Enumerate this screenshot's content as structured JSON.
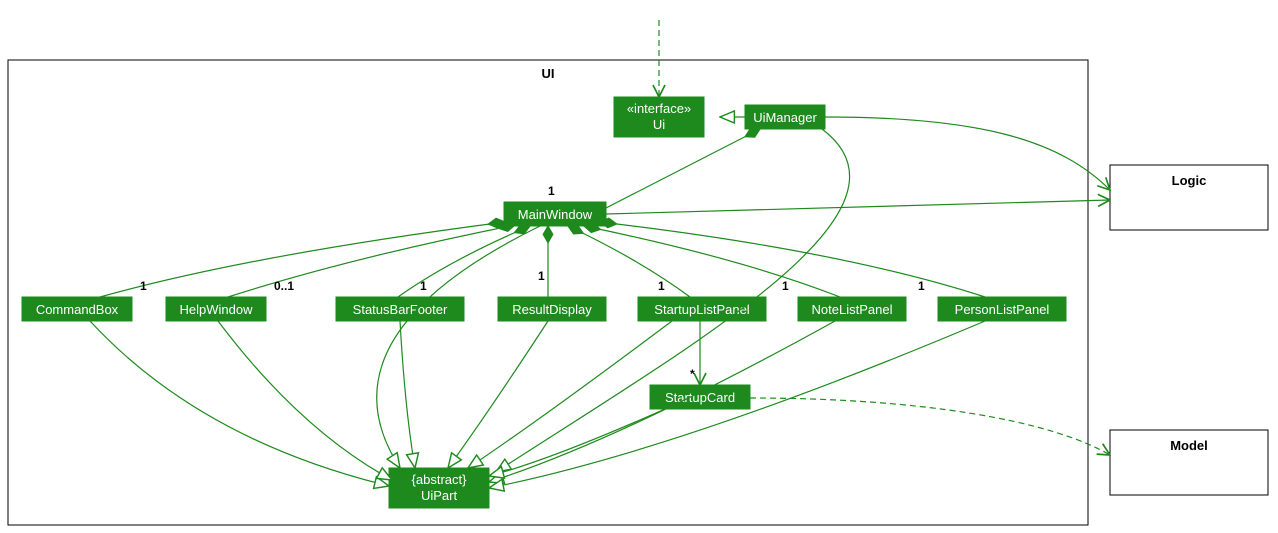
{
  "package": {
    "name": "UI"
  },
  "external": {
    "logic": "Logic",
    "model": "Model"
  },
  "classes": {
    "ui_iface": {
      "stereotype": "«interface»",
      "name": "Ui"
    },
    "ui_manager": "UiManager",
    "main_window": "MainWindow",
    "command_box": "CommandBox",
    "help_window": "HelpWindow",
    "status_bar_footer": "StatusBarFooter",
    "result_display": "ResultDisplay",
    "startup_list_panel": "StartupListPanel",
    "note_list_panel": "NoteListPanel",
    "person_list_panel": "PersonListPanel",
    "startup_card": "StartupCard",
    "ui_part": {
      "stereotype": "{abstract}",
      "name": "UiPart"
    }
  },
  "multiplicities": {
    "main_window": "1",
    "command_box": "1",
    "help_window": "0..1",
    "status_bar_footer": "1",
    "result_display": "1",
    "startup_list_panel": "1",
    "note_list_panel": "1",
    "person_list_panel": "1",
    "startup_card": "*"
  },
  "chart_data": {
    "type": "uml-class-diagram",
    "packages": [
      {
        "name": "UI",
        "contains": [
          "Ui",
          "UiManager",
          "MainWindow",
          "CommandBox",
          "HelpWindow",
          "StatusBarFooter",
          "ResultDisplay",
          "StartupListPanel",
          "NoteListPanel",
          "PersonListPanel",
          "StartupCard",
          "UiPart"
        ]
      }
    ],
    "external_classes": [
      "Logic",
      "Model"
    ],
    "classes": [
      {
        "name": "Ui",
        "stereotype": "interface"
      },
      {
        "name": "UiManager"
      },
      {
        "name": "MainWindow"
      },
      {
        "name": "CommandBox"
      },
      {
        "name": "HelpWindow"
      },
      {
        "name": "StatusBarFooter"
      },
      {
        "name": "ResultDisplay"
      },
      {
        "name": "StartupListPanel"
      },
      {
        "name": "NoteListPanel"
      },
      {
        "name": "PersonListPanel"
      },
      {
        "name": "StartupCard"
      },
      {
        "name": "UiPart",
        "stereotype": "abstract"
      }
    ],
    "relationships": [
      {
        "from": "(external)",
        "to": "Ui",
        "type": "dependency"
      },
      {
        "from": "UiManager",
        "to": "Ui",
        "type": "realization"
      },
      {
        "from": "UiManager",
        "to": "MainWindow",
        "type": "composition",
        "multiplicity": "1"
      },
      {
        "from": "UiManager",
        "to": "Logic",
        "type": "association-directed"
      },
      {
        "from": "MainWindow",
        "to": "Logic",
        "type": "association-directed"
      },
      {
        "from": "MainWindow",
        "to": "CommandBox",
        "type": "composition",
        "multiplicity": "1"
      },
      {
        "from": "MainWindow",
        "to": "HelpWindow",
        "type": "composition",
        "multiplicity": "0..1"
      },
      {
        "from": "MainWindow",
        "to": "StatusBarFooter",
        "type": "composition",
        "multiplicity": "1"
      },
      {
        "from": "MainWindow",
        "to": "ResultDisplay",
        "type": "composition",
        "multiplicity": "1"
      },
      {
        "from": "MainWindow",
        "to": "StartupListPanel",
        "type": "composition",
        "multiplicity": "1"
      },
      {
        "from": "MainWindow",
        "to": "NoteListPanel",
        "type": "composition",
        "multiplicity": "1"
      },
      {
        "from": "MainWindow",
        "to": "PersonListPanel",
        "type": "composition",
        "multiplicity": "1"
      },
      {
        "from": "StartupListPanel",
        "to": "StartupCard",
        "type": "association-directed",
        "multiplicity": "*"
      },
      {
        "from": "StartupCard",
        "to": "Model",
        "type": "dependency"
      },
      {
        "from": "UiManager",
        "to": "UiPart",
        "type": "generalization"
      },
      {
        "from": "MainWindow",
        "to": "UiPart",
        "type": "generalization"
      },
      {
        "from": "CommandBox",
        "to": "UiPart",
        "type": "generalization"
      },
      {
        "from": "HelpWindow",
        "to": "UiPart",
        "type": "generalization"
      },
      {
        "from": "StatusBarFooter",
        "to": "UiPart",
        "type": "generalization"
      },
      {
        "from": "ResultDisplay",
        "to": "UiPart",
        "type": "generalization"
      },
      {
        "from": "StartupListPanel",
        "to": "UiPart",
        "type": "generalization"
      },
      {
        "from": "NoteListPanel",
        "to": "UiPart",
        "type": "generalization"
      },
      {
        "from": "PersonListPanel",
        "to": "UiPart",
        "type": "generalization"
      },
      {
        "from": "StartupCard",
        "to": "UiPart",
        "type": "generalization"
      }
    ]
  }
}
